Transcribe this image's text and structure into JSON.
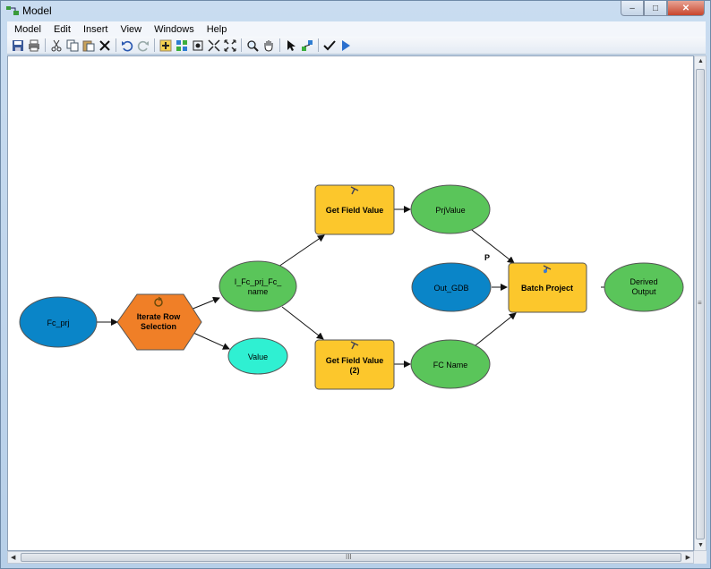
{
  "window": {
    "title": "Model",
    "controls": {
      "minimize": "–",
      "maximize": "□",
      "close": "✕"
    }
  },
  "menu": [
    "Model",
    "Edit",
    "Insert",
    "View",
    "Windows",
    "Help"
  ],
  "toolbar": [
    "save-icon",
    "print-icon",
    "cut-icon",
    "copy-icon",
    "paste-icon",
    "delete-icon",
    "undo-icon",
    "redo-icon",
    "add-data-icon",
    "auto-layout-icon",
    "full-extent-icon",
    "fixed-zoom-in-icon",
    "fixed-zoom-out-icon",
    "zoom-icon",
    "pan-icon",
    "select-icon",
    "add-connection-icon",
    "validate-icon",
    "run-icon"
  ],
  "model": {
    "nodes": {
      "fc_prj": "Fc_prj",
      "iterate_line1": "Iterate Row",
      "iterate_line2": "Selection",
      "i_fc_line1": "I_Fc_prj_Fc_",
      "i_fc_line2": "name",
      "value": "Value",
      "get_field_value": "Get Field Value",
      "get_field_value2_line1": "Get Field Value",
      "get_field_value2_line2": "(2)",
      "prjvalue": "PrjValue",
      "fc_name": "FC Name",
      "out_gdb": "Out_GDB",
      "batch_project": "Batch Project",
      "derived_line1": "Derived",
      "derived_line2": "Output",
      "precondition_label": "P"
    },
    "colors": {
      "input_data": "#0a85c8",
      "iterator": "#f07f27",
      "tool": "#fcc72c",
      "derived": "#5ac55a",
      "value": "#2ff0d2",
      "outline": "#555555"
    }
  },
  "scroll": {
    "h_grip": "III",
    "v_grip": "≡"
  }
}
